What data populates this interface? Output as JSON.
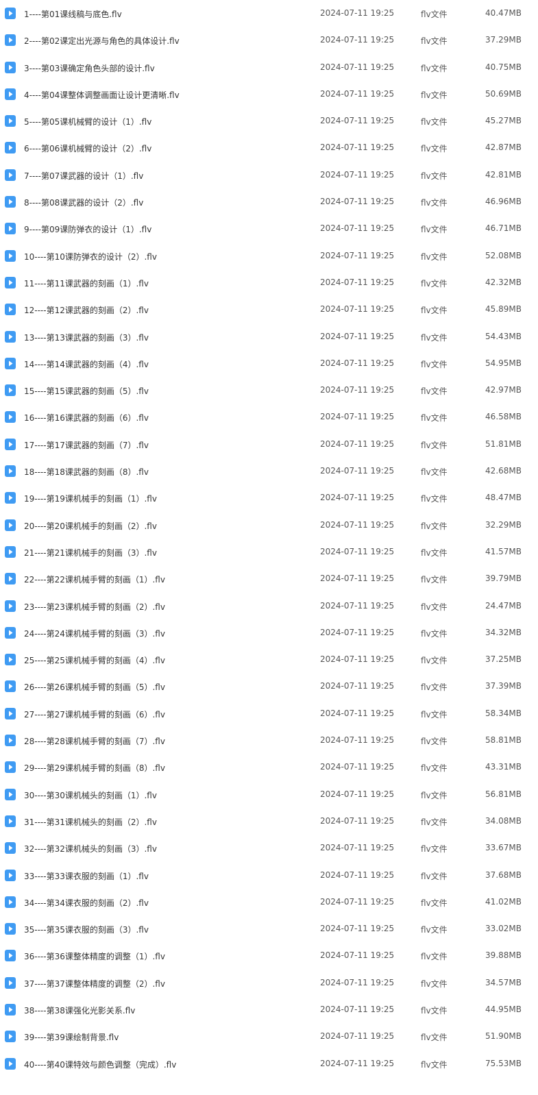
{
  "colors": {
    "icon_accent": "#3f9bf3",
    "text_primary": "#333333",
    "text_secondary": "#555555",
    "background": "#ffffff"
  },
  "icon": "video-file-icon",
  "files": [
    {
      "name": "1----第01课线稿与底色.flv",
      "date": "2024-07-11 19:25",
      "type": "flv文件",
      "size": "40.47MB"
    },
    {
      "name": "2----第02课定出光源与角色的具体设计.flv",
      "date": "2024-07-11 19:25",
      "type": "flv文件",
      "size": "37.29MB"
    },
    {
      "name": "3----第03课确定角色头部的设计.flv",
      "date": "2024-07-11 19:25",
      "type": "flv文件",
      "size": "40.75MB"
    },
    {
      "name": "4----第04课整体调整画面让设计更清晰.flv",
      "date": "2024-07-11 19:25",
      "type": "flv文件",
      "size": "50.69MB"
    },
    {
      "name": "5----第05课机械臂的设计（1）.flv",
      "date": "2024-07-11 19:25",
      "type": "flv文件",
      "size": "45.27MB"
    },
    {
      "name": "6----第06课机械臂的设计（2）.flv",
      "date": "2024-07-11 19:25",
      "type": "flv文件",
      "size": "42.87MB"
    },
    {
      "name": "7----第07课武器的设计（1）.flv",
      "date": "2024-07-11 19:25",
      "type": "flv文件",
      "size": "42.81MB"
    },
    {
      "name": "8----第08课武器的设计（2）.flv",
      "date": "2024-07-11 19:25",
      "type": "flv文件",
      "size": "46.96MB"
    },
    {
      "name": "9----第09课防弹衣的设计（1）.flv",
      "date": "2024-07-11 19:25",
      "type": "flv文件",
      "size": "46.71MB"
    },
    {
      "name": "10----第10课防弹衣的设计（2）.flv",
      "date": "2024-07-11 19:25",
      "type": "flv文件",
      "size": "52.08MB"
    },
    {
      "name": "11----第11课武器的刻画（1）.flv",
      "date": "2024-07-11 19:25",
      "type": "flv文件",
      "size": "42.32MB"
    },
    {
      "name": "12----第12课武器的刻画（2）.flv",
      "date": "2024-07-11 19:25",
      "type": "flv文件",
      "size": "45.89MB"
    },
    {
      "name": "13----第13课武器的刻画（3）.flv",
      "date": "2024-07-11 19:25",
      "type": "flv文件",
      "size": "54.43MB"
    },
    {
      "name": "14----第14课武器的刻画（4）.flv",
      "date": "2024-07-11 19:25",
      "type": "flv文件",
      "size": "54.95MB"
    },
    {
      "name": "15----第15课武器的刻画（5）.flv",
      "date": "2024-07-11 19:25",
      "type": "flv文件",
      "size": "42.97MB"
    },
    {
      "name": "16----第16课武器的刻画（6）.flv",
      "date": "2024-07-11 19:25",
      "type": "flv文件",
      "size": "46.58MB"
    },
    {
      "name": "17----第17课武器的刻画（7）.flv",
      "date": "2024-07-11 19:25",
      "type": "flv文件",
      "size": "51.81MB"
    },
    {
      "name": "18----第18课武器的刻画（8）.flv",
      "date": "2024-07-11 19:25",
      "type": "flv文件",
      "size": "42.68MB"
    },
    {
      "name": "19----第19课机械手的刻画（1）.flv",
      "date": "2024-07-11 19:25",
      "type": "flv文件",
      "size": "48.47MB"
    },
    {
      "name": "20----第20课机械手的刻画（2）.flv",
      "date": "2024-07-11 19:25",
      "type": "flv文件",
      "size": "32.29MB"
    },
    {
      "name": "21----第21课机械手的刻画（3）.flv",
      "date": "2024-07-11 19:25",
      "type": "flv文件",
      "size": "41.57MB"
    },
    {
      "name": "22----第22课机械手臂的刻画（1）.flv",
      "date": "2024-07-11 19:25",
      "type": "flv文件",
      "size": "39.79MB"
    },
    {
      "name": "23----第23课机械手臂的刻画（2）.flv",
      "date": "2024-07-11 19:25",
      "type": "flv文件",
      "size": "24.47MB"
    },
    {
      "name": "24----第24课机械手臂的刻画（3）.flv",
      "date": "2024-07-11 19:25",
      "type": "flv文件",
      "size": "34.32MB"
    },
    {
      "name": "25----第25课机械手臂的刻画（4）.flv",
      "date": "2024-07-11 19:25",
      "type": "flv文件",
      "size": "37.25MB"
    },
    {
      "name": "26----第26课机械手臂的刻画（5）.flv",
      "date": "2024-07-11 19:25",
      "type": "flv文件",
      "size": "37.39MB"
    },
    {
      "name": "27----第27课机械手臂的刻画（6）.flv",
      "date": "2024-07-11 19:25",
      "type": "flv文件",
      "size": "58.34MB"
    },
    {
      "name": "28----第28课机械手臂的刻画（7）.flv",
      "date": "2024-07-11 19:25",
      "type": "flv文件",
      "size": "58.81MB"
    },
    {
      "name": "29----第29课机械手臂的刻画（8）.flv",
      "date": "2024-07-11 19:25",
      "type": "flv文件",
      "size": "43.31MB"
    },
    {
      "name": "30----第30课机械头的刻画（1）.flv",
      "date": "2024-07-11 19:25",
      "type": "flv文件",
      "size": "56.81MB"
    },
    {
      "name": "31----第31课机械头的刻画（2）.flv",
      "date": "2024-07-11 19:25",
      "type": "flv文件",
      "size": "34.08MB"
    },
    {
      "name": "32----第32课机械头的刻画（3）.flv",
      "date": "2024-07-11 19:25",
      "type": "flv文件",
      "size": "33.67MB"
    },
    {
      "name": "33----第33课衣服的刻画（1）.flv",
      "date": "2024-07-11 19:25",
      "type": "flv文件",
      "size": "37.68MB"
    },
    {
      "name": "34----第34课衣服的刻画（2）.flv",
      "date": "2024-07-11 19:25",
      "type": "flv文件",
      "size": "41.02MB"
    },
    {
      "name": "35----第35课衣服的刻画（3）.flv",
      "date": "2024-07-11 19:25",
      "type": "flv文件",
      "size": "33.02MB"
    },
    {
      "name": "36----第36课整体精度的调整（1）.flv",
      "date": "2024-07-11 19:25",
      "type": "flv文件",
      "size": "39.88MB"
    },
    {
      "name": "37----第37课整体精度的调整（2）.flv",
      "date": "2024-07-11 19:25",
      "type": "flv文件",
      "size": "34.57MB"
    },
    {
      "name": "38----第38课强化光影关系.flv",
      "date": "2024-07-11 19:25",
      "type": "flv文件",
      "size": "44.95MB"
    },
    {
      "name": "39----第39课绘制背景.flv",
      "date": "2024-07-11 19:25",
      "type": "flv文件",
      "size": "51.90MB"
    },
    {
      "name": "40----第40课特效与颜色调整（完成）.flv",
      "date": "2024-07-11 19:25",
      "type": "flv文件",
      "size": "75.53MB"
    }
  ]
}
